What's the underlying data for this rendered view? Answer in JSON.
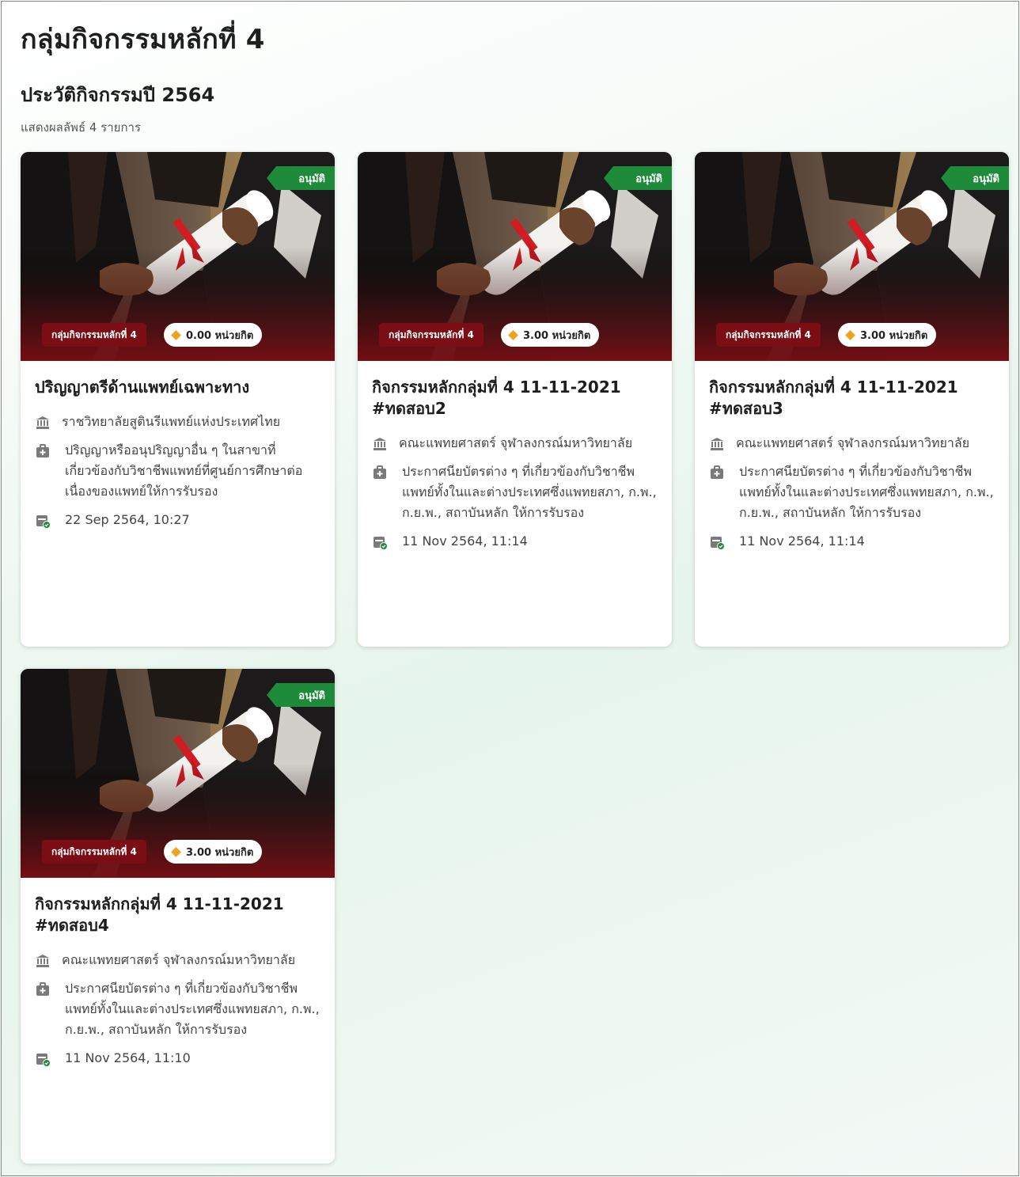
{
  "page": {
    "title": "กลุ่มกิจกรรมหลักที่ 4",
    "section_title": "ประวัติกิจกรรมปี 2564",
    "result_count": "แสดงผลลัพธ์ 4 รายการ"
  },
  "colors": {
    "approved": "#1e8b3a",
    "group_tag": "#7a0e14",
    "credit_diamond": "#f0a21b"
  },
  "cards": [
    {
      "status": "อนุมัติ",
      "group": "กลุ่มกิจกรรมหลักที่ 4",
      "credits": "0.00 หน่วยกิต",
      "title": "ปริญญาตรีด้านแพทย์เฉพาะทาง",
      "institution": "ราชวิทยาลัยสูตินรีแพทย์แห่งประเทศไทย",
      "description": "ปริญญาหรืออนุปริญญาอื่น ๆ ในสาขาที่เกี่ยวข้องกับวิชาชีพแพทย์ที่ศูนย์การศึกษาต่อเนื่องของแพทย์ให้การรับรอง",
      "date": "22 Sep 2564, 10:27"
    },
    {
      "status": "อนุมัติ",
      "group": "กลุ่มกิจกรรมหลักที่ 4",
      "credits": "3.00 หน่วยกิต",
      "title": "กิจกรรมหลักกลุ่มที่ 4 11-11-2021 #ทดสอบ2",
      "institution": "คณะแพทยศาสตร์ จุฬาลงกรณ์มหาวิทยาลัย",
      "description": "ประกาศนียบัตรต่าง ๆ ที่เกี่ยวข้องกับวิชาชีพแพทย์ทั้งในและต่างประเทศซึ่งแพทยสภา, ก.พ., ก.ย.พ., สถาบันหลัก ให้การรับรอง",
      "date": "11 Nov 2564, 11:14"
    },
    {
      "status": "อนุมัติ",
      "group": "กลุ่มกิจกรรมหลักที่ 4",
      "credits": "3.00 หน่วยกิต",
      "title": "กิจกรรมหลักกลุ่มที่ 4 11-11-2021 #ทดสอบ3",
      "institution": "คณะแพทยศาสตร์ จุฬาลงกรณ์มหาวิทยาลัย",
      "description": "ประกาศนียบัตรต่าง ๆ ที่เกี่ยวข้องกับวิชาชีพแพทย์ทั้งในและต่างประเทศซึ่งแพทยสภา, ก.พ., ก.ย.พ., สถาบันหลัก ให้การรับรอง",
      "date": "11 Nov 2564, 11:14"
    },
    {
      "status": "อนุมัติ",
      "group": "กลุ่มกิจกรรมหลักที่ 4",
      "credits": "3.00 หน่วยกิต",
      "title": "กิจกรรมหลักกลุ่มที่ 4 11-11-2021 #ทดสอบ4",
      "institution": "คณะแพทยศาสตร์ จุฬาลงกรณ์มหาวิทยาลัย",
      "description": "ประกาศนียบัตรต่าง ๆ ที่เกี่ยวข้องกับวิชาชีพแพทย์ทั้งในและต่างประเทศซึ่งแพทยสภา, ก.พ., ก.ย.พ., สถาบันหลัก ให้การรับรอง",
      "date": "11 Nov 2564, 11:10"
    }
  ]
}
